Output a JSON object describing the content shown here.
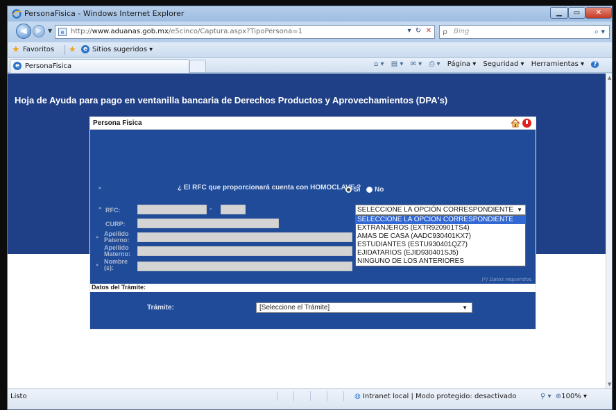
{
  "window": {
    "title": "PersonaFisica - Windows Internet Explorer",
    "minimize_label": "▁",
    "maximize_label": "▭",
    "close_label": "✕"
  },
  "address": {
    "url_prefix": "http://",
    "url_host": "www.aduanas.gob.mx",
    "url_path": "/e5cinco/Captura.aspx?TipoPersona=1",
    "search_placeholder": "Bing"
  },
  "favorites": {
    "label": "Favoritos",
    "suggested": "Sitios sugeridos ▾"
  },
  "tab": {
    "title": "PersonaFisica"
  },
  "command_bar": {
    "page": "Página ▾",
    "security": "Seguridad ▾",
    "tools": "Herramientas ▾"
  },
  "page": {
    "heading": "Hoja de Ayuda para pago en ventanilla bancaria de Derechos Productos y Aprovechamientos (DPA's)",
    "panel_title": "Persona Fisica",
    "homoclave_question": "¿ El RFC que proporcionará cuenta con HOMOCLAVE ?",
    "radio_yes": "Si",
    "radio_no": "No",
    "labels": {
      "rfc": "RFC:",
      "curp": "CURP:",
      "apellido_paterno_1": "Apellido",
      "apellido_paterno_2": "Paterno:",
      "apellido_materno_1": "Apellido",
      "apellido_materno_2": "Materno:",
      "nombre_1": "Nombre",
      "nombre_2": "(s):"
    },
    "rfc_dash": "-",
    "rfc_select_value": "SELECCIONE LA OPCIÓN CORRESPONDIENTE",
    "rfc_options": [
      "SELECCIONE LA OPCION CORRESPONDIENTE",
      "EXTRANJEROS (EXTR920901TS4)",
      "AMAS DE CASA (AADC930401KX7)",
      "ESTUDIANTES (ESTU930401QZ7)",
      "EJIDATARIOS (EJID930401SJ5)",
      "NINGUNO DE LOS ANTERIORES"
    ],
    "required_note": "(*) Datos requeridos.",
    "tramite_section": "Datos del Trámite:",
    "tramite_label": "Trámite:",
    "tramite_select_value": "[Seleccione el Trámite]"
  },
  "status": {
    "left": "Listo",
    "zone": "Intranet local | Modo protegido: desactivado",
    "zoom": "100%"
  }
}
